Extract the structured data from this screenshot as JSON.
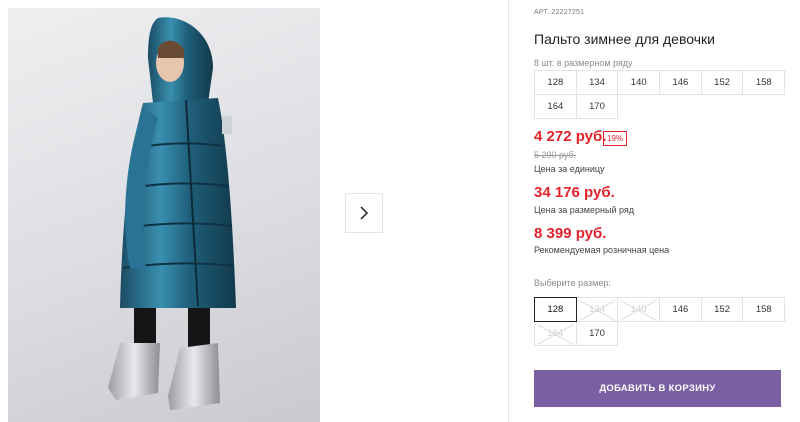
{
  "product": {
    "article": "АРТ. 22227251",
    "title": "Пальто зимнее для девочки",
    "row_note": "8 шт. в размерном ряду"
  },
  "size_row": [
    "128",
    "134",
    "140",
    "146",
    "152",
    "158",
    "164",
    "170"
  ],
  "prices": {
    "unit_price": "4 272 руб.",
    "discount": "19%",
    "old_price": "5 290 руб.",
    "unit_caption": "Цена за единицу",
    "row_price": "34 176 руб.",
    "row_caption": "Цена за размерный ряд",
    "retail_price": "8 399 руб.",
    "retail_caption": "Рекомендуемая розничная цена"
  },
  "size_select": {
    "label": "Выберите размер:",
    "options": [
      {
        "label": "128",
        "state": "selected"
      },
      {
        "label": "134",
        "state": "disabled"
      },
      {
        "label": "140",
        "state": "disabled"
      },
      {
        "label": "146",
        "state": "available"
      },
      {
        "label": "152",
        "state": "available"
      },
      {
        "label": "158",
        "state": "available"
      },
      {
        "label": "164",
        "state": "disabled"
      },
      {
        "label": "170",
        "state": "available"
      }
    ]
  },
  "cart_button": "ДОБАВИТЬ В КОРЗИНУ",
  "gallery": {
    "next_icon": "chevron-right-icon"
  },
  "colors": {
    "price_red": "#e3232c",
    "button_purple": "#7b5fa3",
    "coat_teal": "#1f5f7a"
  }
}
